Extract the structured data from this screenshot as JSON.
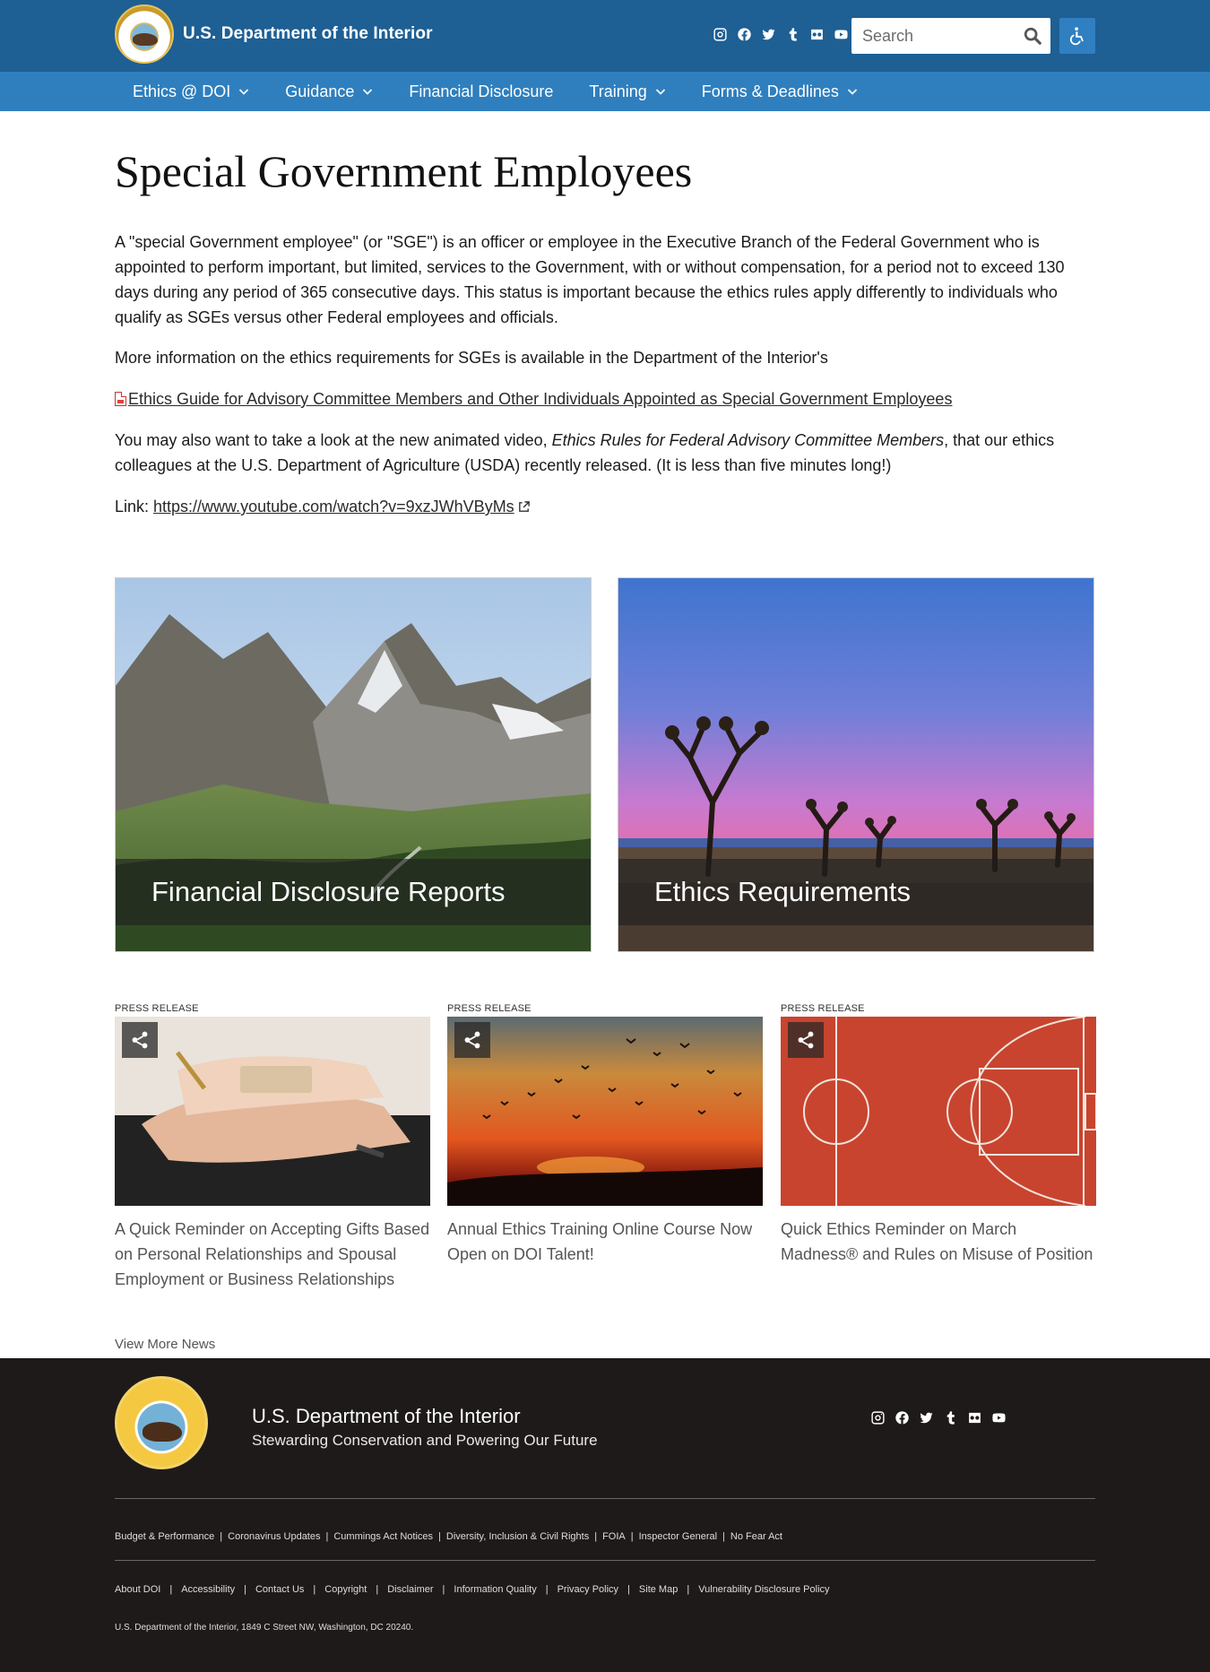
{
  "header": {
    "site_title": "U.S. Department of the Interior",
    "search_placeholder": "Search",
    "social": [
      "instagram-icon",
      "facebook-icon",
      "twitter-icon",
      "tumblr-icon",
      "flickr-icon",
      "youtube-icon"
    ]
  },
  "nav": {
    "items": [
      {
        "label": "Ethics @ DOI",
        "has_dropdown": true
      },
      {
        "label": "Guidance",
        "has_dropdown": true
      },
      {
        "label": "Financial Disclosure",
        "has_dropdown": false
      },
      {
        "label": "Training",
        "has_dropdown": true
      },
      {
        "label": "Forms & Deadlines",
        "has_dropdown": true
      }
    ]
  },
  "main": {
    "title": "Special Government Employees",
    "p1": "A \"special Government employee\" (or \"SGE\") is an officer or employee in the Executive Branch of the Federal Government who is appointed to perform important, but limited, services to the Government, with or without compensation, for a period not to exceed 130 days during any period of 365 consecutive days. This status is important because the ethics rules apply differently to individuals who qualify as SGEs versus other Federal employees and officials.",
    "p2": "More information on the ethics requirements for SGEs is available in the Department of the Interior's",
    "guide_link": "Ethics Guide for Advisory Committee Members and Other Individuals Appointed as Special Government Employees",
    "p4_before": "You may also want to take a look at the new animated video, ",
    "p4_italic": "Ethics Rules for Federal Advisory Committee Members",
    "p4_after": ", that our ethics colleagues at the U.S. Department of Agriculture (USDA) recently released.  (It is less than five minutes long!)",
    "link_label": "Link: ",
    "video_url": "https://www.youtube.com/watch?v=9xzJWhVByMs"
  },
  "features": [
    {
      "label": "Financial Disclosure Reports"
    },
    {
      "label": "Ethics Requirements"
    }
  ],
  "news": {
    "items": [
      {
        "kicker": "PRESS RELEASE",
        "title": "A Quick Reminder on Accepting Gifts Based on Personal Relationships and Spousal Employment or Business Relationships"
      },
      {
        "kicker": "PRESS RELEASE",
        "title": "Annual Ethics Training Online Course Now Open on DOI Talent!"
      },
      {
        "kicker": "PRESS RELEASE",
        "title": "Quick Ethics Reminder on March Madness® and Rules on Misuse of Position"
      }
    ],
    "view_more": "View More News"
  },
  "footer": {
    "name": "U.S. Department of the Interior",
    "tagline": "Stewarding Conservation and Powering Our Future",
    "links_row1": [
      "Budget & Performance",
      "Coronavirus Updates",
      "Cummings Act Notices",
      "Diversity, Inclusion & Civil Rights",
      "FOIA",
      "Inspector General",
      "No Fear Act"
    ],
    "links_row2": [
      "About DOI",
      "Accessibility",
      "Contact Us",
      "Copyright",
      "Disclaimer",
      "Information Quality",
      "Privacy Policy",
      "Site Map",
      "Vulnerability Disclosure Policy"
    ],
    "address": "U.S. Department of the Interior, 1849 C Street NW, Washington, DC 20240."
  },
  "colors": {
    "header_bg": "#1e5f94",
    "nav_bg": "#2f7fbe",
    "footer_bg": "#1f1a1a"
  }
}
